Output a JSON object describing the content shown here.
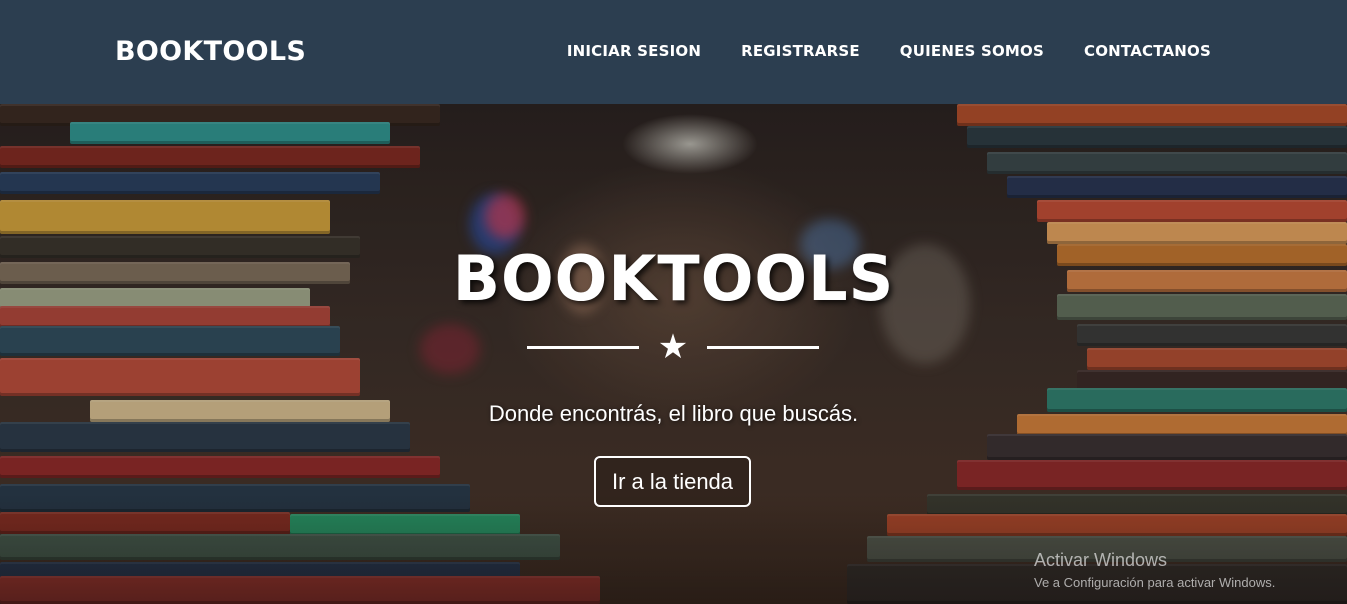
{
  "navbar": {
    "brand": "BOOKTOOLS",
    "links": [
      {
        "label": "INICIAR SESION"
      },
      {
        "label": "REGISTRARSE"
      },
      {
        "label": "QUIENES SOMOS"
      },
      {
        "label": "CONTACTANOS"
      }
    ]
  },
  "hero": {
    "title": "BOOKTOOLS",
    "divider_icon": "star-icon",
    "tagline": "Donde encontrás, el libro que buscás.",
    "cta_label": "Ir a la tienda"
  },
  "watermark": {
    "title": "Activar Windows",
    "subtitle": "Ve a Configuración para activar Windows."
  },
  "colors": {
    "navbar_bg": "#2c3e50",
    "text": "#ffffff"
  }
}
